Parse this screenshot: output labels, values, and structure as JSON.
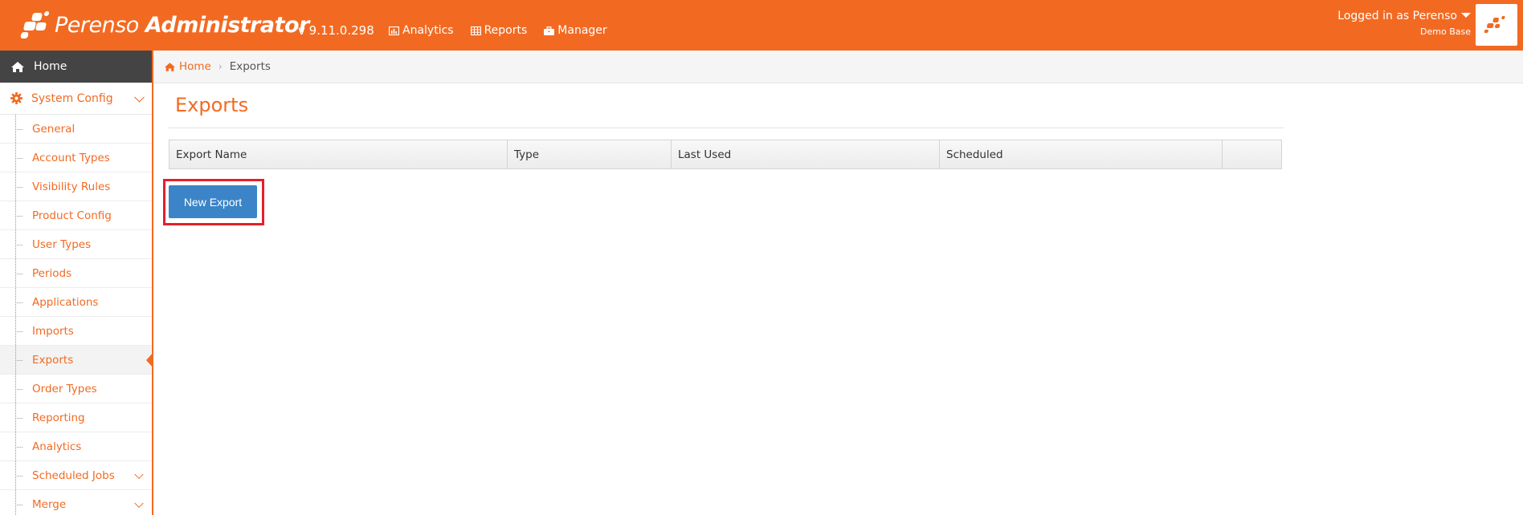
{
  "header": {
    "brand_light": "Perenso",
    "brand_bold": "Administrator",
    "version": "v 9.11.0.298",
    "nav": [
      {
        "label": "Analytics",
        "icon": "chart-icon"
      },
      {
        "label": "Reports",
        "icon": "table-icon"
      },
      {
        "label": "Manager",
        "icon": "briefcase-icon"
      }
    ],
    "user_label": "Logged in as Perenso",
    "database": "Demo Base"
  },
  "sidebar": {
    "home": "Home",
    "section": "System Config",
    "items": [
      {
        "label": "General"
      },
      {
        "label": "Account Types"
      },
      {
        "label": "Visibility Rules"
      },
      {
        "label": "Product Config"
      },
      {
        "label": "User Types"
      },
      {
        "label": "Periods"
      },
      {
        "label": "Applications"
      },
      {
        "label": "Imports"
      },
      {
        "label": "Exports",
        "active": true
      },
      {
        "label": "Order Types"
      },
      {
        "label": "Reporting"
      },
      {
        "label": "Analytics"
      },
      {
        "label": "Scheduled Jobs",
        "expandable": true
      },
      {
        "label": "Merge",
        "expandable": true
      }
    ]
  },
  "breadcrumb": {
    "home": "Home",
    "current": "Exports"
  },
  "main": {
    "title": "Exports",
    "columns": [
      "Export Name",
      "Type",
      "Last Used",
      "Scheduled",
      ""
    ],
    "new_button": "New Export"
  },
  "colors": {
    "brand": "#f26a22",
    "button": "#3b84c8",
    "highlight": "#e3202c",
    "sidebar_home_bg": "#444444"
  }
}
